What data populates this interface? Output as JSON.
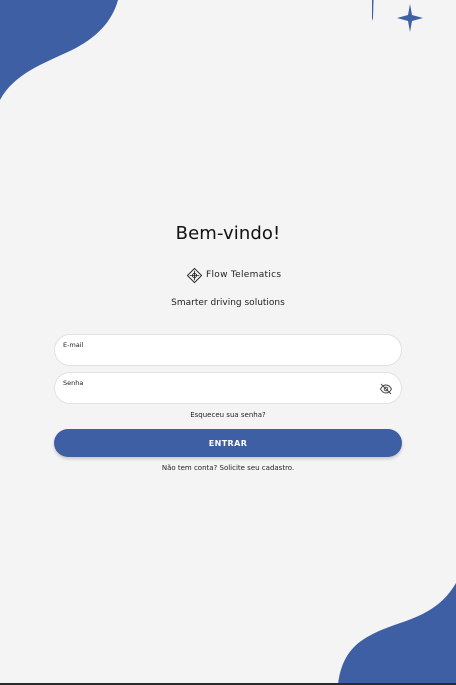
{
  "theme": {
    "accent": "#3e5fa3",
    "background": "#f4f4f4",
    "field_bg": "#ffffff"
  },
  "header": {
    "title": "Bem-vindo!"
  },
  "brand": {
    "name": "Flow Telematics",
    "logo_icon": "diamond-cross-logo-icon",
    "tagline": "Smarter driving solutions"
  },
  "form": {
    "email": {
      "label": "E-mail",
      "value": "",
      "placeholder": ""
    },
    "password": {
      "label": "Senha",
      "value": "",
      "placeholder": "",
      "toggle_icon": "eye-off-icon"
    },
    "forgot_label": "Esqueceu sua senha?",
    "submit_label": "ENTRAR",
    "signup_text": "Não tem conta? Solicite seu cadastro."
  }
}
